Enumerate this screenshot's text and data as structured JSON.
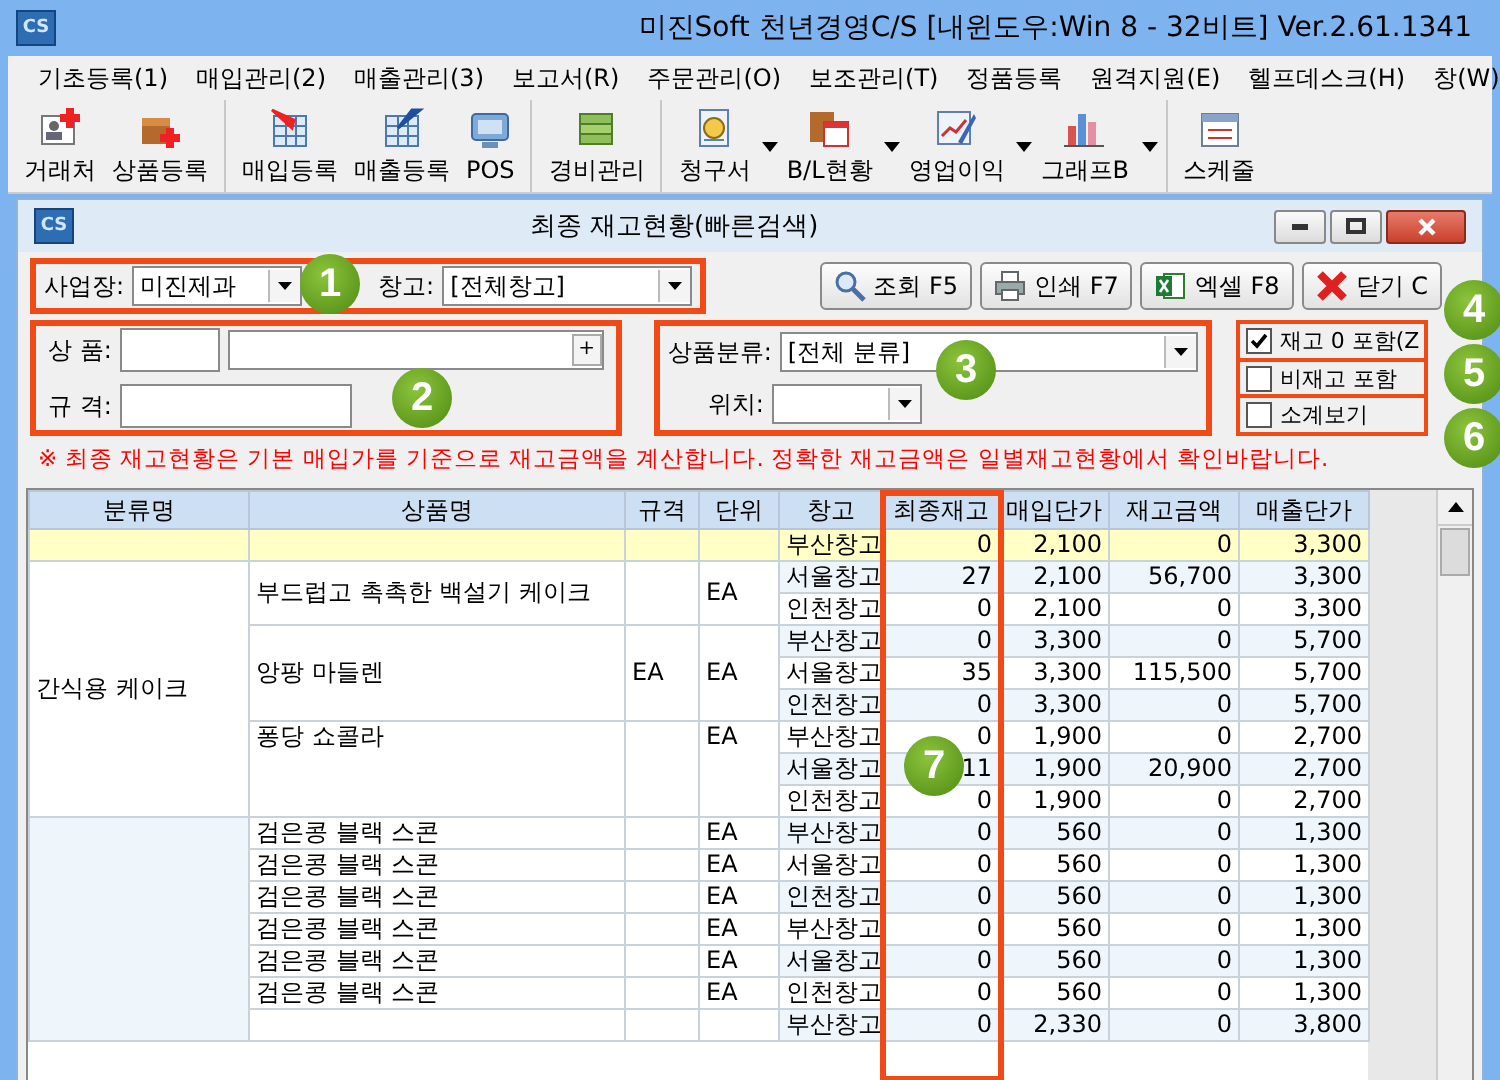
{
  "window": {
    "icon_text": "CS",
    "title": "미진Soft 천년경영C/S [내윈도우:Win 8 - 32비트] Ver.2.61.1341"
  },
  "menu": [
    "기초등록(1)",
    "매입관리(2)",
    "매출관리(3)",
    "보고서(R)",
    "주문관리(O)",
    "보조관리(T)",
    "정품등록",
    "원격지원(E)",
    "헬프데스크(H)",
    "창(W)"
  ],
  "toolbar": {
    "groups": [
      [
        {
          "label": "거래처",
          "has_menu": false
        },
        {
          "label": "상품등록",
          "has_menu": false
        }
      ],
      [
        {
          "label": "매입등록",
          "has_menu": false
        },
        {
          "label": "매출등록",
          "has_menu": false
        },
        {
          "label": "POS",
          "has_menu": false
        }
      ],
      [
        {
          "label": "경비관리",
          "has_menu": false
        }
      ],
      [
        {
          "label": "청구서",
          "has_menu": true
        },
        {
          "label": "B/L현황",
          "has_menu": true
        },
        {
          "label": "영업이익",
          "has_menu": true
        },
        {
          "label": "그래프B",
          "has_menu": true
        }
      ],
      [
        {
          "label": "스케줄",
          "has_menu": false
        }
      ]
    ]
  },
  "document": {
    "icon_text": "CS",
    "title": "최종 재고현황(빠른검색)",
    "business_label": "사업장:",
    "business_value": "미진제과",
    "warehouse_label": "창고:",
    "warehouse_value": "[전체창고]",
    "buttons": [
      {
        "label": "조회 F5"
      },
      {
        "label": "인쇄 F7"
      },
      {
        "label": "엑셀 F8"
      },
      {
        "label": "닫기 C"
      }
    ],
    "product_label": "상 품:",
    "add_button": "+",
    "spec_label": "규 격:",
    "category_label": "상품분류:",
    "category_value": "[전체 분류]",
    "location_label": "위치:",
    "options": [
      {
        "label": "재고 0 포함(Z",
        "checked": true
      },
      {
        "label": "비재고 포함",
        "checked": false
      },
      {
        "label": "소계보기",
        "checked": false
      }
    ],
    "notice": "※ 최종 재고현황은 기본 매입가를 기준으로 재고금액을 계산합니다. 정확한 재고금액은 일별재고현황에서 확인바랍니다."
  },
  "annotations": [
    "1",
    "2",
    "3",
    "4",
    "5",
    "6",
    "7"
  ],
  "table": {
    "columns": [
      "분류명",
      "상품명",
      "규격",
      "단위",
      "창고",
      "최종재고",
      "매입단가",
      "재고금액",
      "매출단가"
    ],
    "first_row": {
      "warehouse": "부산창고",
      "stock": "0",
      "cost": "2,100",
      "amount": "0",
      "price": "3,300"
    },
    "groups": [
      {
        "category": "간식용 케이크",
        "products": [
          {
            "name": "부드럽고 촉촉한 백설기 케이크",
            "unit": "EA",
            "rows": [
              {
                "warehouse": "서울창고",
                "stock": "27",
                "cost": "2,100",
                "amount": "56,700",
                "price": "3,300"
              },
              {
                "warehouse": "인천창고",
                "stock": "0",
                "cost": "2,100",
                "amount": "0",
                "price": "3,300"
              }
            ]
          },
          {
            "name": "앙팡 마들렌",
            "spec": "EA",
            "unit": "EA",
            "rows": [
              {
                "warehouse": "부산창고",
                "stock": "0",
                "cost": "3,300",
                "amount": "0",
                "price": "5,700"
              },
              {
                "warehouse": "서울창고",
                "stock": "35",
                "cost": "3,300",
                "amount": "115,500",
                "price": "5,700"
              },
              {
                "warehouse": "인천창고",
                "stock": "0",
                "cost": "3,300",
                "amount": "0",
                "price": "5,700"
              }
            ]
          },
          {
            "name": "퐁당 쇼콜라",
            "unit": "EA",
            "rows": [
              {
                "warehouse": "부산창고",
                "stock": "0",
                "cost": "1,900",
                "amount": "0",
                "price": "2,700"
              },
              {
                "warehouse": "서울창고",
                "stock": "11",
                "cost": "1,900",
                "amount": "20,900",
                "price": "2,700"
              },
              {
                "warehouse": "인천창고",
                "stock": "0",
                "cost": "1,900",
                "amount": "0",
                "price": "2,700"
              }
            ]
          }
        ]
      },
      {
        "products": [
          {
            "name": "검은콩 블랙 스콘",
            "unit": "EA",
            "rows": [
              {
                "warehouse": "부산창고",
                "stock": "0",
                "cost": "560",
                "amount": "0",
                "price": "1,300"
              }
            ]
          },
          {
            "name": "검은콩 블랙 스콘",
            "unit": "EA",
            "rows": [
              {
                "warehouse": "서울창고",
                "stock": "0",
                "cost": "560",
                "amount": "0",
                "price": "1,300"
              }
            ]
          },
          {
            "name": "검은콩 블랙 스콘",
            "unit": "EA",
            "rows": [
              {
                "warehouse": "인천창고",
                "stock": "0",
                "cost": "560",
                "amount": "0",
                "price": "1,300"
              }
            ]
          },
          {
            "name": "검은콩 블랙 스콘",
            "unit": "EA",
            "rows": [
              {
                "warehouse": "부산창고",
                "stock": "0",
                "cost": "560",
                "amount": "0",
                "price": "1,300"
              }
            ]
          },
          {
            "name": "검은콩 블랙 스콘",
            "unit": "EA",
            "rows": [
              {
                "warehouse": "서울창고",
                "stock": "0",
                "cost": "560",
                "amount": "0",
                "price": "1,300"
              }
            ]
          },
          {
            "name": "검은콩 블랙 스콘",
            "unit": "EA",
            "rows": [
              {
                "warehouse": "인천창고",
                "stock": "0",
                "cost": "560",
                "amount": "0",
                "price": "1,300"
              }
            ]
          },
          {
            "rows": [
              {
                "warehouse": "부산창고",
                "stock": "0",
                "cost": "2,330",
                "amount": "0",
                "price": "3,800"
              }
            ]
          }
        ]
      }
    ]
  }
}
